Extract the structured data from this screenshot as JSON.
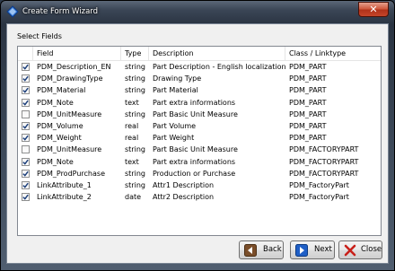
{
  "window": {
    "title": "Create Form Wizard",
    "close_glyph": "✕"
  },
  "section_label": "Select Fields",
  "columns": [
    "Field",
    "Type",
    "Description",
    "Class / Linktype"
  ],
  "rows": [
    {
      "checked": true,
      "field": "PDM_Description_EN",
      "type": "string",
      "description": "Part Description - English localization",
      "class": "PDM_PART"
    },
    {
      "checked": true,
      "field": "PDM_DrawingType",
      "type": "string",
      "description": "Drawing Type",
      "class": "PDM_PART"
    },
    {
      "checked": true,
      "field": "PDM_Material",
      "type": "string",
      "description": "Part Material",
      "class": "PDM_PART"
    },
    {
      "checked": true,
      "field": "PDM_Note",
      "type": "text",
      "description": "Part extra informations",
      "class": "PDM_PART"
    },
    {
      "checked": false,
      "field": "PDM_UnitMeasure",
      "type": "string",
      "description": "Part Basic Unit Measure",
      "class": "PDM_PART"
    },
    {
      "checked": true,
      "field": "PDM_Volume",
      "type": "real",
      "description": "Part Volume",
      "class": "PDM_PART"
    },
    {
      "checked": true,
      "field": "PDM_Weight",
      "type": "real",
      "description": "Part Weight",
      "class": "PDM_PART"
    },
    {
      "checked": false,
      "field": "PDM_UnitMeasure",
      "type": "string",
      "description": "Part Basic Unit Measure",
      "class": "PDM_FACTORYPART"
    },
    {
      "checked": true,
      "field": "PDM_Note",
      "type": "text",
      "description": "Part extra informations",
      "class": "PDM_FACTORYPART"
    },
    {
      "checked": true,
      "field": "PDM_ProdPurchase",
      "type": "string",
      "description": "Production or Purchase",
      "class": "PDM_FACTORYPART"
    },
    {
      "checked": true,
      "field": "LinkAttribute_1",
      "type": "string",
      "description": "Attr1 Description",
      "class": "PDM_FactoryPart"
    },
    {
      "checked": true,
      "field": "LinkAttribute_2",
      "type": "date",
      "description": "Attr2 Description",
      "class": "PDM_FactoryPart"
    }
  ],
  "buttons": {
    "back": "Back",
    "next": "Next",
    "close": "Close"
  },
  "icons": {
    "app": "app-logo-icon",
    "back": "back-arrow-icon",
    "next": "next-arrow-icon",
    "close": "close-x-icon"
  },
  "colors": {
    "back_icon": "#7a4e2a",
    "next_icon": "#1f5fc6",
    "close_icon": "#c8201a"
  }
}
